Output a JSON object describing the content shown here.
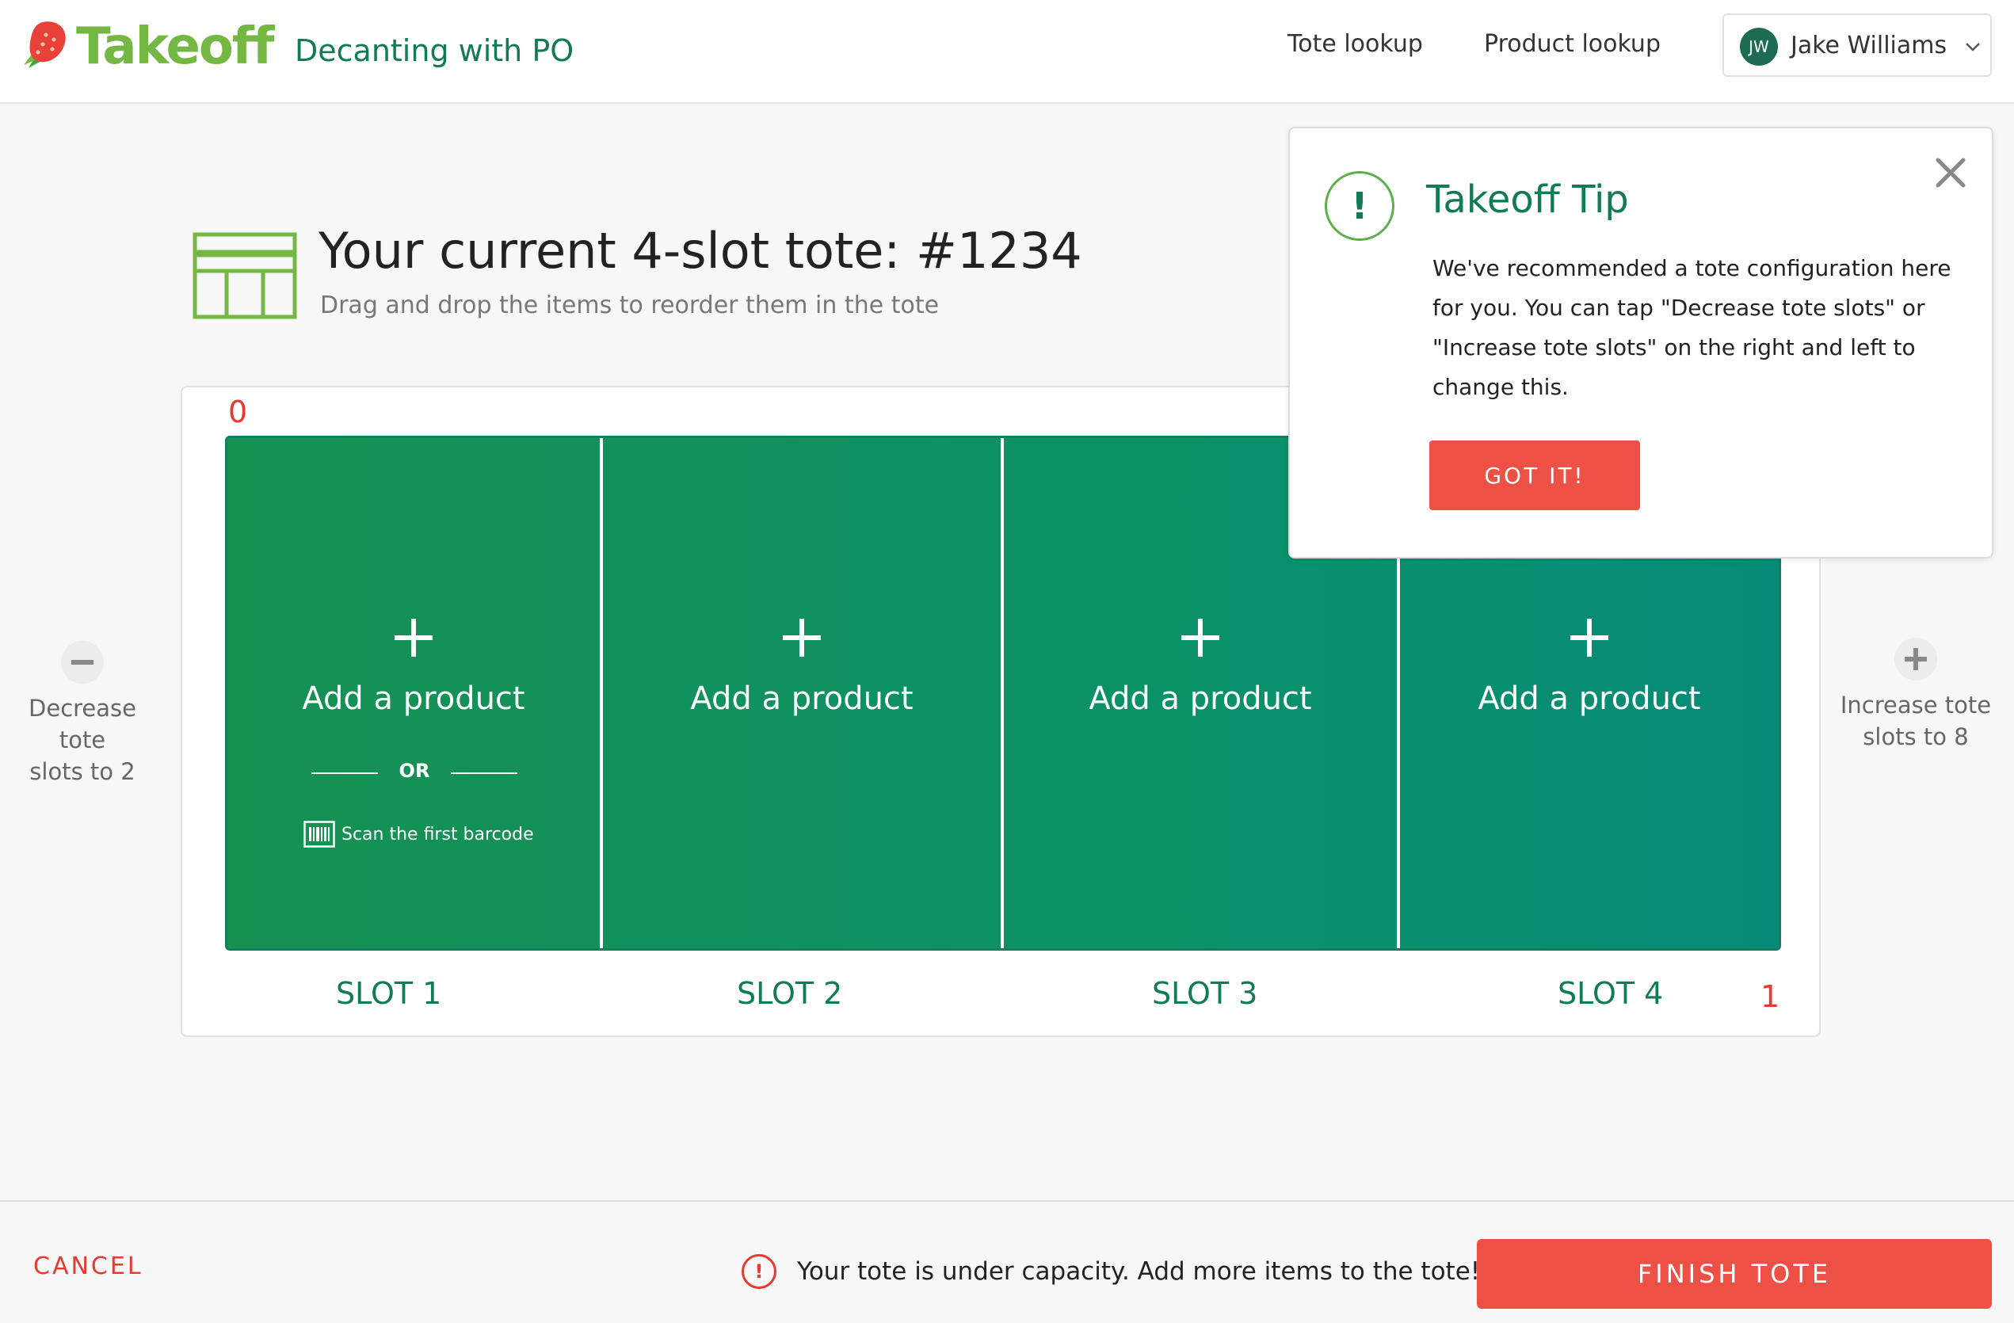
{
  "header": {
    "logo_text": "Takeoff",
    "app_title": "Decanting with PO",
    "nav": [
      "Tote lookup",
      "Product lookup"
    ],
    "user": {
      "initials": "JW",
      "name": "Jake Williams"
    }
  },
  "tote": {
    "title": "Your current 4-slot tote: #1234",
    "subtitle": "Drag and drop the items to reorder them in the tote",
    "marker_left": "0",
    "marker_right": "1",
    "slots": [
      {
        "label": "Add a product",
        "caption": "SLOT 1"
      },
      {
        "label": "Add a product",
        "caption": "SLOT 2"
      },
      {
        "label": "Add a product",
        "caption": "SLOT 3"
      },
      {
        "label": "Add a product",
        "caption": "SLOT 4"
      }
    ],
    "or_text": "OR",
    "scan_text": "Scan the first barcode"
  },
  "side_controls": {
    "decrease": "Decrease tote slots to 2",
    "decrease_line1": "Decrease tote",
    "decrease_line2": "slots to 2",
    "increase_line1": "Increase tote",
    "increase_line2": "slots to 8"
  },
  "tip": {
    "icon": "!",
    "title": "Takeoff Tip",
    "body": "We've recommended a tote configuration here for you. You can tap \"Decrease tote slots\" or \"Increase tote slots\" on the right and left to change this.",
    "button": "GOT IT!"
  },
  "footer": {
    "cancel": "CANCEL",
    "warning_icon": "!",
    "warning": "Your tote is under capacity. Add more items to the tote!",
    "finish": "FINISH TOTE"
  },
  "colors": {
    "brand_green": "#74b843",
    "dark_green": "#117a57",
    "slot_green": "#0f9160",
    "accent_red": "#ee5046"
  }
}
